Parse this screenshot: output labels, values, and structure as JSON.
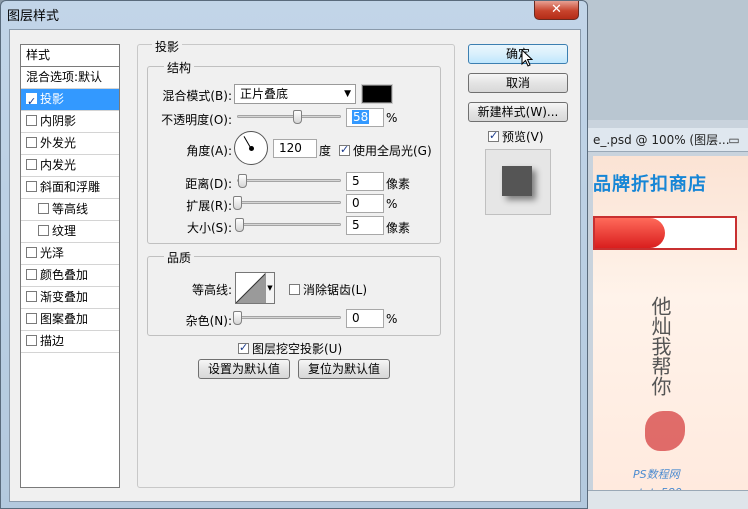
{
  "background": {
    "doc_title": "e_.psd @ 100% (图层...",
    "store_name": "品牌折扣商店",
    "calligraphy": "他灿我帮你",
    "watermark": "PS数程网",
    "watermark_url": "www.tata580.com"
  },
  "dialog": {
    "title": "图层样式",
    "close_label": "✕"
  },
  "styles": {
    "header": "样式",
    "items": [
      {
        "label": "混合选项:默认",
        "checkbox": false,
        "checked": false,
        "selected": false
      },
      {
        "label": "投影",
        "checkbox": true,
        "checked": true,
        "selected": true
      },
      {
        "label": "内阴影",
        "checkbox": true,
        "checked": false,
        "selected": false
      },
      {
        "label": "外发光",
        "checkbox": true,
        "checked": false,
        "selected": false
      },
      {
        "label": "内发光",
        "checkbox": true,
        "checked": false,
        "selected": false
      },
      {
        "label": "斜面和浮雕",
        "checkbox": true,
        "checked": false,
        "selected": false
      },
      {
        "label": "等高线",
        "checkbox": true,
        "checked": false,
        "selected": false,
        "sub": true
      },
      {
        "label": "纹理",
        "checkbox": true,
        "checked": false,
        "selected": false,
        "sub": true
      },
      {
        "label": "光泽",
        "checkbox": true,
        "checked": false,
        "selected": false
      },
      {
        "label": "颜色叠加",
        "checkbox": true,
        "checked": false,
        "selected": false
      },
      {
        "label": "渐变叠加",
        "checkbox": true,
        "checked": false,
        "selected": false
      },
      {
        "label": "图案叠加",
        "checkbox": true,
        "checked": false,
        "selected": false
      },
      {
        "label": "描边",
        "checkbox": true,
        "checked": false,
        "selected": false
      }
    ]
  },
  "shadow": {
    "section_title": "投影",
    "structure": {
      "title": "结构",
      "blend_mode_label": "混合模式(B):",
      "blend_mode_value": "正片叠底",
      "color": "#000000",
      "opacity_label": "不透明度(O):",
      "opacity_value": "58",
      "opacity_fraction": 0.58,
      "percent": "%",
      "angle_label": "角度(A):",
      "angle_value": "120",
      "angle_unit": "度",
      "global_light_label": "使用全局光(G)",
      "distance_label": "距离(D):",
      "distance_value": "5",
      "distance_fraction": 0.05,
      "spread_label": "扩展(R):",
      "spread_value": "0",
      "size_label": "大小(S):",
      "size_value": "5",
      "size_fraction": 0.02,
      "pixel_unit": "像素"
    },
    "quality": {
      "title": "品质",
      "contour_label": "等高线:",
      "antialias_label": "消除锯齿(L)",
      "noise_label": "杂色(N):",
      "noise_value": "0",
      "percent": "%"
    },
    "knockout_label": "图层挖空投影(U)",
    "set_default_label": "设置为默认值",
    "reset_default_label": "复位为默认值"
  },
  "actions": {
    "ok_label": "确定",
    "cancel_label": "取消",
    "new_style_label": "新建样式(W)...",
    "preview_label": "预览(V)"
  }
}
